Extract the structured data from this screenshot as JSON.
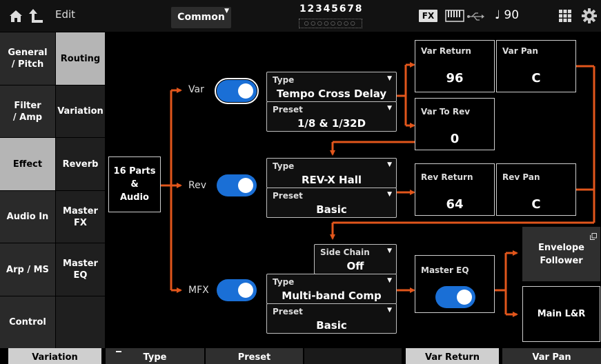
{
  "topbar": {
    "edit_label": "Edit",
    "common_label": "Common",
    "parts_numbers": "12345678",
    "parts_dots": "○○○○○○○○",
    "fx_label": "FX",
    "tempo": "♩ 90"
  },
  "left_nav": [
    {
      "label": "General\n/ Pitch"
    },
    {
      "label": "Filter\n/ Amp"
    },
    {
      "label": "Effect"
    },
    {
      "label": "Audio In"
    },
    {
      "label": "Arp / MS"
    },
    {
      "label": "Control"
    }
  ],
  "sub_nav": [
    {
      "label": "Routing"
    },
    {
      "label": "Variation"
    },
    {
      "label": "Reverb"
    },
    {
      "label": "Master\nFX"
    },
    {
      "label": "Master\nEQ"
    }
  ],
  "source": "16 Parts\n&\nAudio",
  "var": {
    "label": "Var",
    "type_label": "Type",
    "type_value": "Tempo Cross Delay",
    "preset_label": "Preset",
    "preset_value": "1/8 & 1/32D",
    "return_label": "Var Return",
    "return_value": "96",
    "pan_label": "Var Pan",
    "pan_value": "C",
    "to_rev_label": "Var To Rev",
    "to_rev_value": "0"
  },
  "rev": {
    "label": "Rev",
    "type_label": "Type",
    "type_value": "REV-X Hall",
    "preset_label": "Preset",
    "preset_value": "Basic",
    "return_label": "Rev Return",
    "return_value": "64",
    "pan_label": "Rev Pan",
    "pan_value": "C"
  },
  "mfx": {
    "label": "MFX",
    "sidechain_label": "Side Chain",
    "sidechain_value": "Off",
    "type_label": "Type",
    "type_value": "Multi-band Comp",
    "preset_label": "Preset",
    "preset_value": "Basic"
  },
  "master_eq": {
    "label": "Master EQ"
  },
  "envelope_follower": "Envelope\nFollower",
  "main_lr": "Main L&R",
  "bottom_tabs": [
    {
      "label": "Variation"
    },
    {
      "label": "Type"
    },
    {
      "label": "Preset"
    },
    {
      "label": ""
    },
    {
      "label": "Var Return"
    },
    {
      "label": "Var Pan"
    }
  ],
  "colors": {
    "accent_orange": "#e2561b",
    "toggle_blue": "#1a6fd6"
  }
}
